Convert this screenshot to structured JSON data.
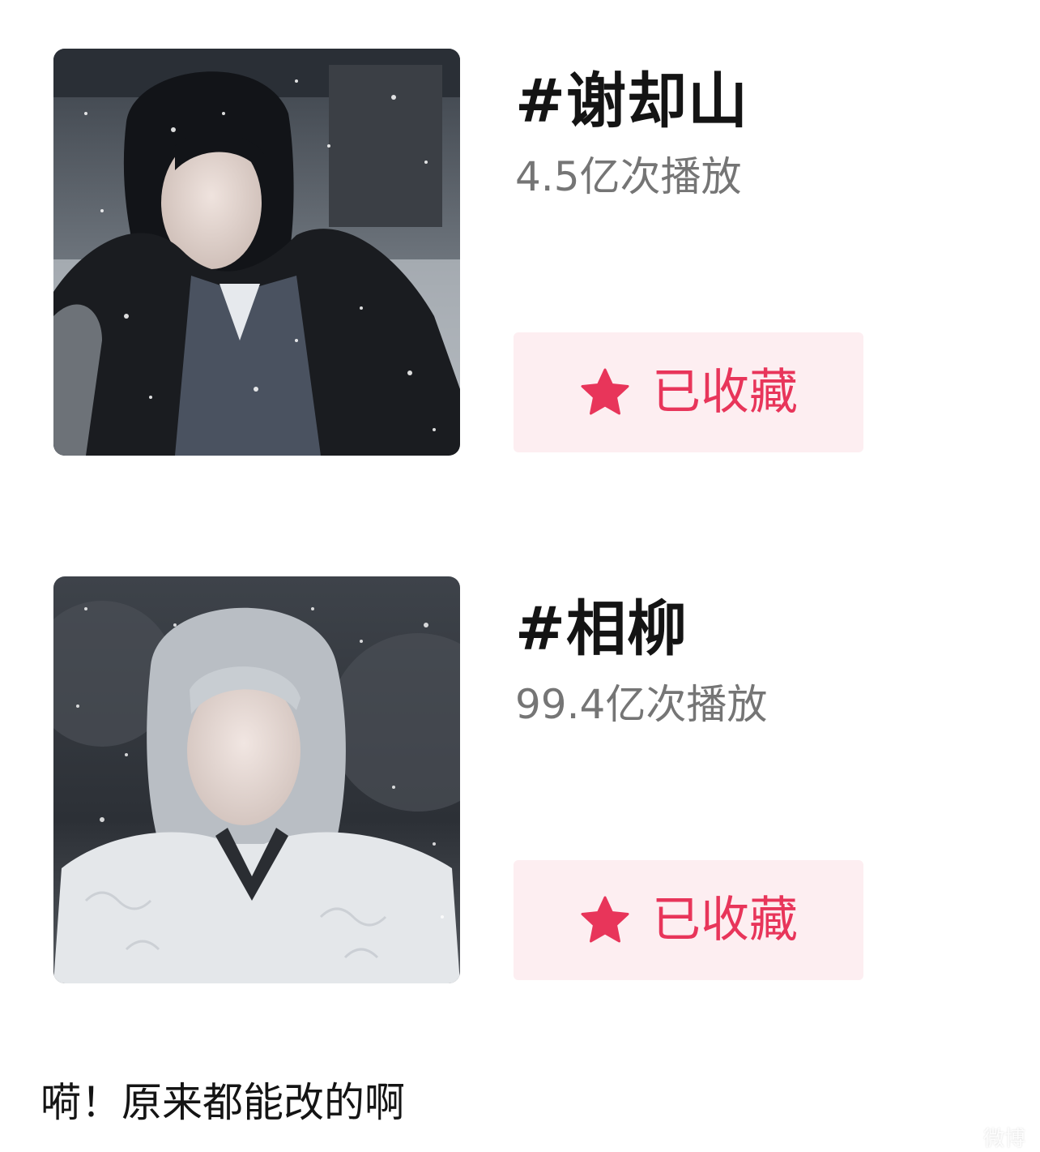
{
  "items": [
    {
      "title": "#谢却山",
      "plays": "4.5亿次播放",
      "favorite_label": "已收藏",
      "star_color": "#e8355a",
      "button_bg": "#fdeef1",
      "icon": "star-icon"
    },
    {
      "title": "#相柳",
      "plays": "99.4亿次播放",
      "favorite_label": "已收藏",
      "star_color": "#e8355a",
      "button_bg": "#fdeef1",
      "icon": "star-icon"
    }
  ],
  "caption": "嗬！原来都能改的啊",
  "watermark": "微博"
}
